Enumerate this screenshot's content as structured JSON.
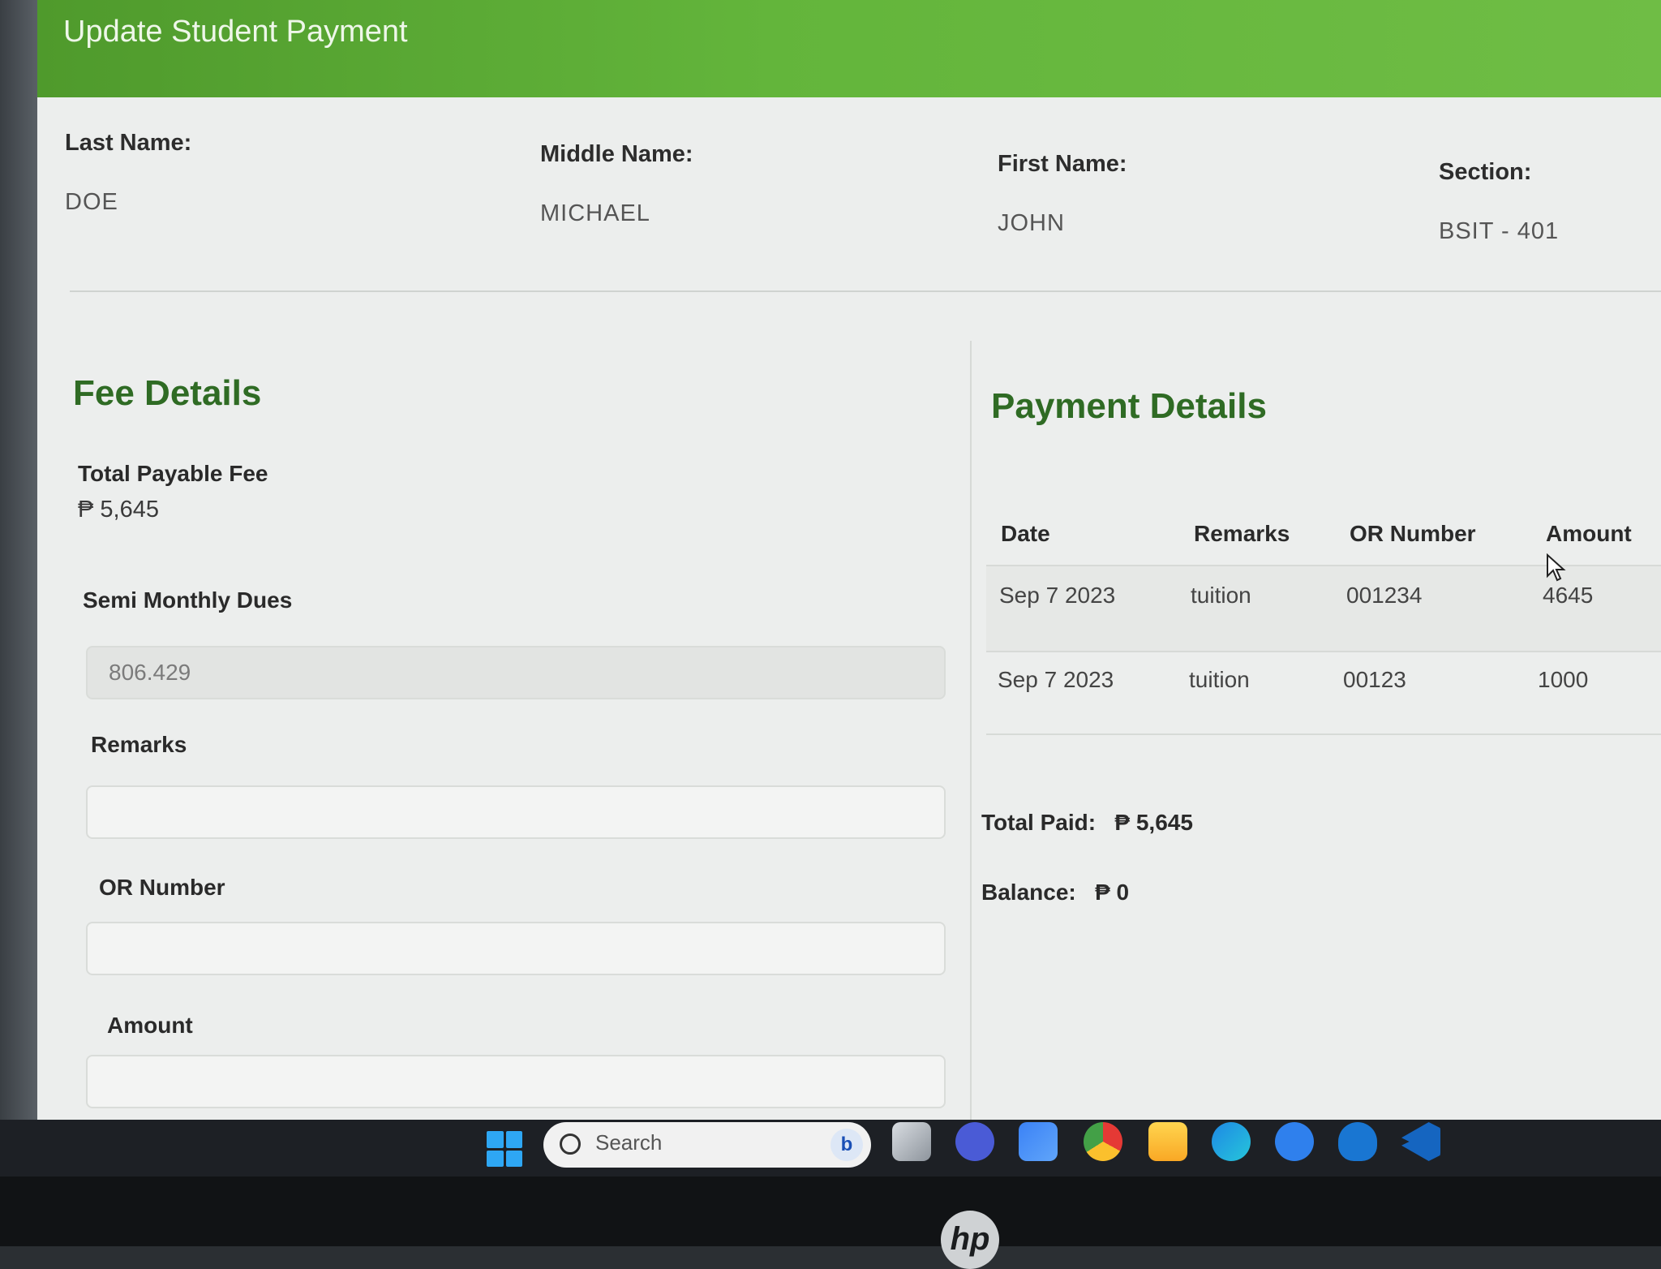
{
  "header": {
    "title": "Update Student Payment"
  },
  "student": {
    "last_name_label": "Last Name:",
    "last_name": "DOE",
    "middle_name_label": "Middle Name:",
    "middle_name": "MICHAEL",
    "first_name_label": "First Name:",
    "first_name": "JOHN",
    "section_label": "Section:",
    "section": "BSIT - 401"
  },
  "fee": {
    "title": "Fee Details",
    "total_payable_label": "Total Payable Fee",
    "total_payable_value": "₱ 5,645",
    "semi_monthly_label": "Semi Monthly Dues",
    "semi_monthly_value": "806.429",
    "remarks_label": "Remarks",
    "remarks_value": "",
    "or_label": "OR Number",
    "or_value": "",
    "amount_label": "Amount",
    "amount_value": ""
  },
  "payment": {
    "title": "Payment Details",
    "columns": [
      "Date",
      "Remarks",
      "OR Number",
      "Amount"
    ],
    "rows": [
      {
        "date": "Sep 7 2023",
        "remarks": "tuition",
        "or": "001234",
        "amount": "4645"
      },
      {
        "date": "Sep 7 2023",
        "remarks": "tuition",
        "or": "00123",
        "amount": "1000"
      }
    ],
    "total_paid_label": "Total Paid:",
    "total_paid_value": "₱ 5,645",
    "balance_label": "Balance:",
    "balance_value": "₱ 0"
  },
  "taskbar": {
    "search_placeholder": "Search",
    "bing_glyph": "b",
    "icons": [
      "start-icon",
      "search-icon",
      "bing-icon",
      "task-view-icon",
      "meet-icon",
      "store-icon",
      "chrome-icon",
      "file-explorer-icon",
      "edge-icon",
      "help-icon",
      "app-icon",
      "vscode-icon"
    ]
  },
  "device": {
    "brand_glyph": "hp"
  },
  "colors": {
    "header_green": "#5fae37",
    "title_green": "#2f6b24"
  }
}
